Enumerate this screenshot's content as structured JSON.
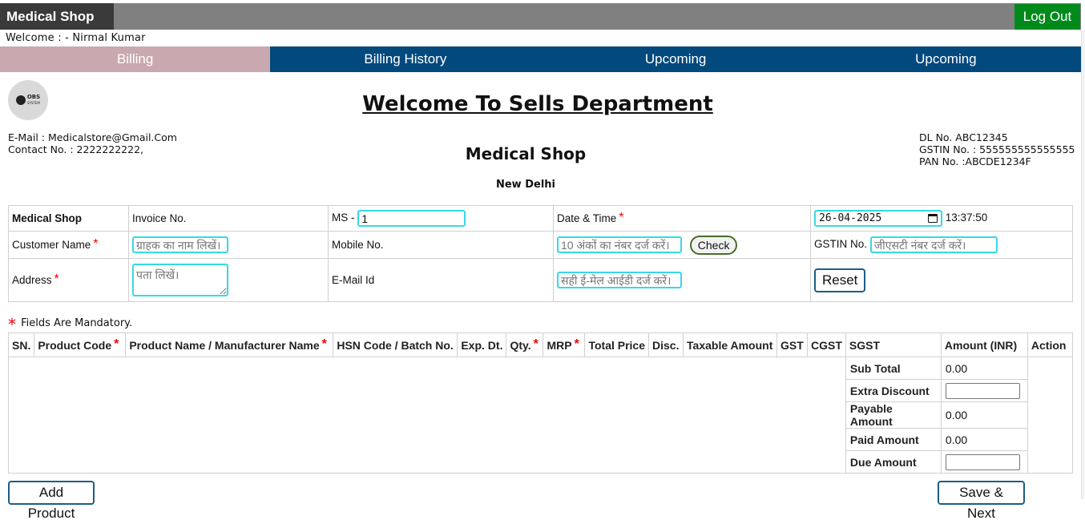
{
  "header": {
    "brand": "Medical Shop",
    "logout_label": "Log Out",
    "welcome_text": "Welcome : - Nirmal Kumar"
  },
  "nav": {
    "tabs": [
      {
        "label": "Billing",
        "active": true
      },
      {
        "label": "Billing History",
        "active": false
      },
      {
        "label": "Upcoming",
        "active": false
      },
      {
        "label": "Upcoming",
        "active": false
      }
    ]
  },
  "logo": {
    "line1": "OBS",
    "line2": "SYSTEM"
  },
  "page": {
    "heading": "Welcome To Sells Department",
    "email_line": "E-Mail : Medicalstore@Gmail.Com",
    "contact_line": "Contact No. : 2222222222,",
    "dl_line": "DL No. ABC12345",
    "gstin_line": "GSTIN No. : 555555555555555",
    "pan_line": "PAN No. :ABCDE1234F",
    "shop_name": "Medical Shop",
    "city": "New Delhi"
  },
  "form": {
    "shop_label": "Medical Shop",
    "invoice_label": "Invoice No.",
    "invoice_prefix": "MS -",
    "invoice_value": "1",
    "datetime_label": "Date & Time",
    "date_value": "26-04-2025",
    "time_value": "13:37:50",
    "customer_label": "Customer Name",
    "customer_placeholder": "ग्राहक का नाम लिखें।",
    "mobile_label": "Mobile No.",
    "mobile_placeholder": "10 अंकों का नंबर दर्ज करें।",
    "check_label": "Check",
    "gstin_label": "GSTIN No.",
    "gstin_placeholder": "जीएसटी नंबर दर्ज करें।",
    "address_label": "Address",
    "address_placeholder": "पता लिखें।",
    "email_label": "E-Mail Id",
    "email_placeholder": "सही ई-मेल आईडी दर्ज करें।",
    "reset_label": "Reset",
    "required_mark": "*",
    "mandatory_note": "Fields Are Mandatory."
  },
  "products": {
    "columns": [
      "SN.",
      "Product Code",
      "Product Name / Manufacturer Name",
      "HSN Code / Batch No.",
      "Exp. Dt.",
      "Qty.",
      "MRP",
      "Total Price",
      "Disc.",
      "Taxable Amount",
      "GST",
      "CGST",
      "SGST",
      "Amount (INR)",
      "Action"
    ],
    "summary": [
      {
        "label": "Sub Total",
        "value": "0.00"
      },
      {
        "label": "Extra Discount",
        "value": ""
      },
      {
        "label": "Payable Amount",
        "value": "0.00"
      },
      {
        "label": "Paid Amount",
        "value": "0.00"
      },
      {
        "label": "Due Amount",
        "value": ""
      }
    ]
  },
  "actions": {
    "add_product_label": "Add Product",
    "save_next_label": "Save & Next"
  },
  "colors": {
    "topbar": "#808080",
    "brand_bg": "#3a3a3a",
    "logout_bg": "#008a1c",
    "nav_bg": "#02497d",
    "nav_active_bg": "#c9a8b0",
    "input_focus_border": "#36d9e6",
    "required": "#ee0000"
  }
}
